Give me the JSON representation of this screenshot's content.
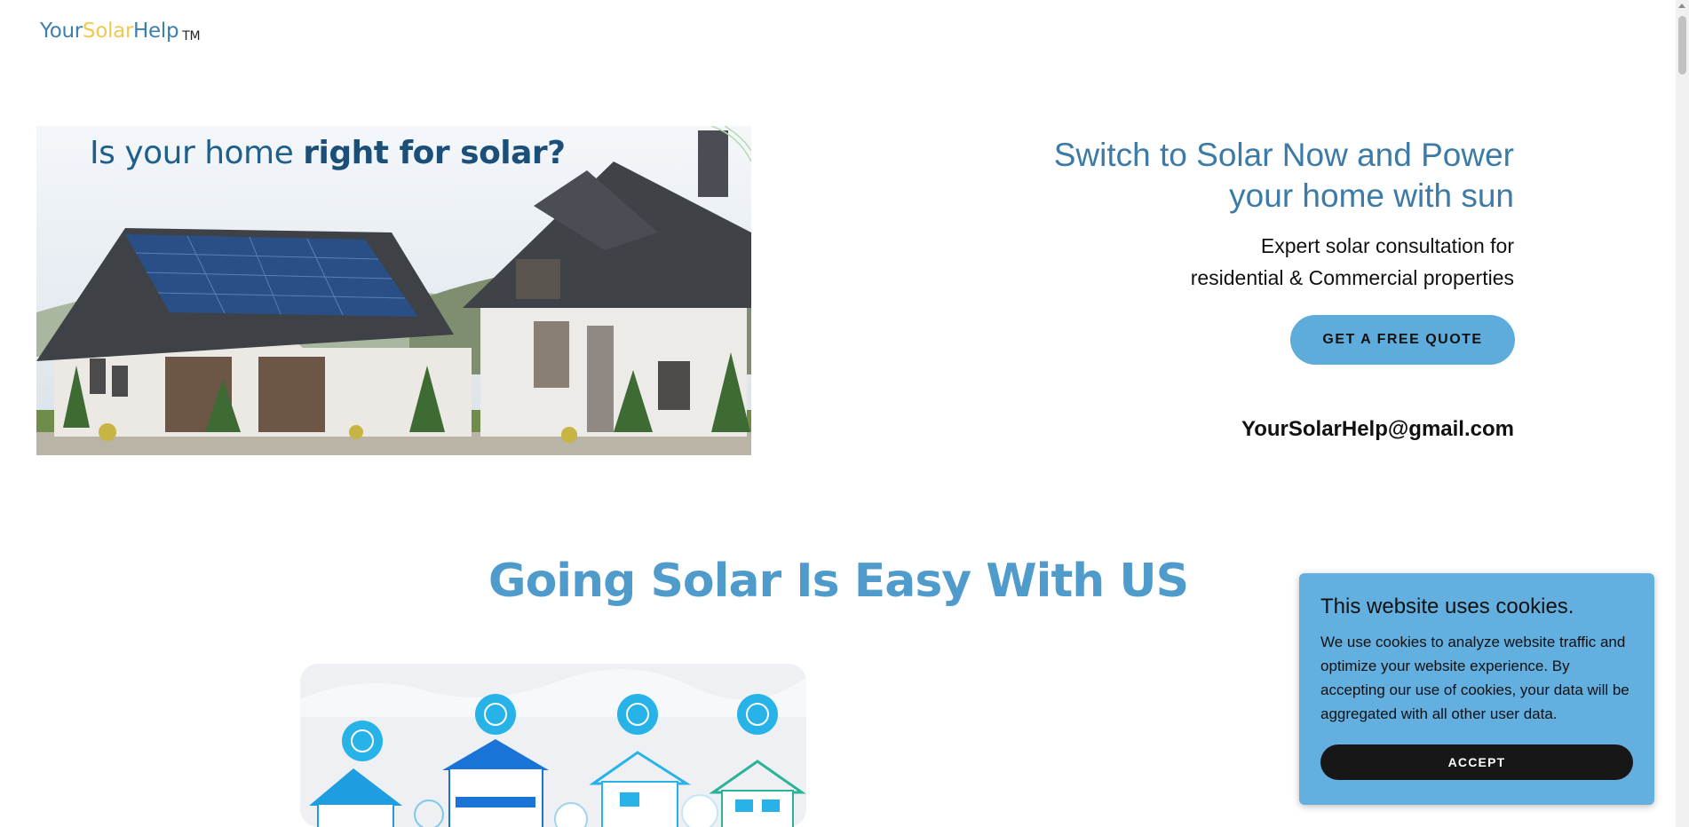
{
  "header": {
    "logo": {
      "part1": "Your",
      "part2": "Solar",
      "part3": "Help",
      "tm": "TM"
    }
  },
  "hero": {
    "image_caption_regular": "Is your home ",
    "image_caption_bold": "right for solar?",
    "title_line1": "Switch to Solar Now and Power",
    "title_line2": "your home with sun",
    "subtitle_line1": "Expert solar consultation for",
    "subtitle_line2": "residential & Commercial properties",
    "cta_label": "GET A FREE QUOTE",
    "email": "YourSolarHelp@gmail.com"
  },
  "section": {
    "title": "Going Solar Is Easy With US"
  },
  "cookie_banner": {
    "title": "This website uses cookies.",
    "text": "We use cookies to analyze website traffic and optimize your website experience. By accepting our use of cookies, your data will be aggregated with all other user data.",
    "accept_label": "ACCEPT"
  },
  "colors": {
    "brand_blue": "#3c7ba7",
    "brand_yellow": "#f2c94c",
    "button_blue": "#5eacdc",
    "cookie_bg": "#62afe0",
    "accept_bg": "#171717"
  }
}
